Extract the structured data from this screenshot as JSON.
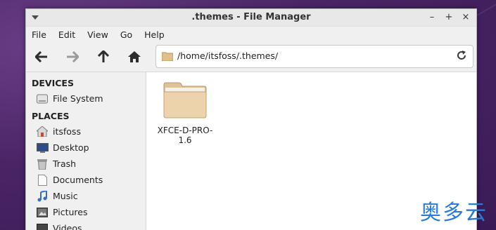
{
  "window": {
    "title": ".themes - File Manager"
  },
  "window_controls": {
    "minimize": "–",
    "maximize": "+",
    "close": "×"
  },
  "menubar": {
    "items": [
      "File",
      "Edit",
      "View",
      "Go",
      "Help"
    ]
  },
  "toolbar": {
    "address": "/home/itsfoss/.themes/"
  },
  "sidebar": {
    "devices_header": "DEVICES",
    "devices": [
      {
        "label": "File System",
        "icon": "drive-icon"
      }
    ],
    "places_header": "PLACES",
    "places": [
      {
        "label": "itsfoss",
        "icon": "home-icon"
      },
      {
        "label": "Desktop",
        "icon": "desktop-icon"
      },
      {
        "label": "Trash",
        "icon": "trash-icon"
      },
      {
        "label": "Documents",
        "icon": "document-icon"
      },
      {
        "label": "Music",
        "icon": "music-icon"
      },
      {
        "label": "Pictures",
        "icon": "pictures-icon"
      },
      {
        "label": "Videos",
        "icon": "videos-icon"
      }
    ]
  },
  "content": {
    "items": [
      {
        "name": "XFCE-D-PRO-1.6",
        "icon": "folder-icon"
      }
    ]
  },
  "watermark": "奥多云",
  "colors": {
    "folder": "#e8c89a",
    "watermark": "#2a7bd6",
    "desktop_bg": "#4a2566"
  }
}
